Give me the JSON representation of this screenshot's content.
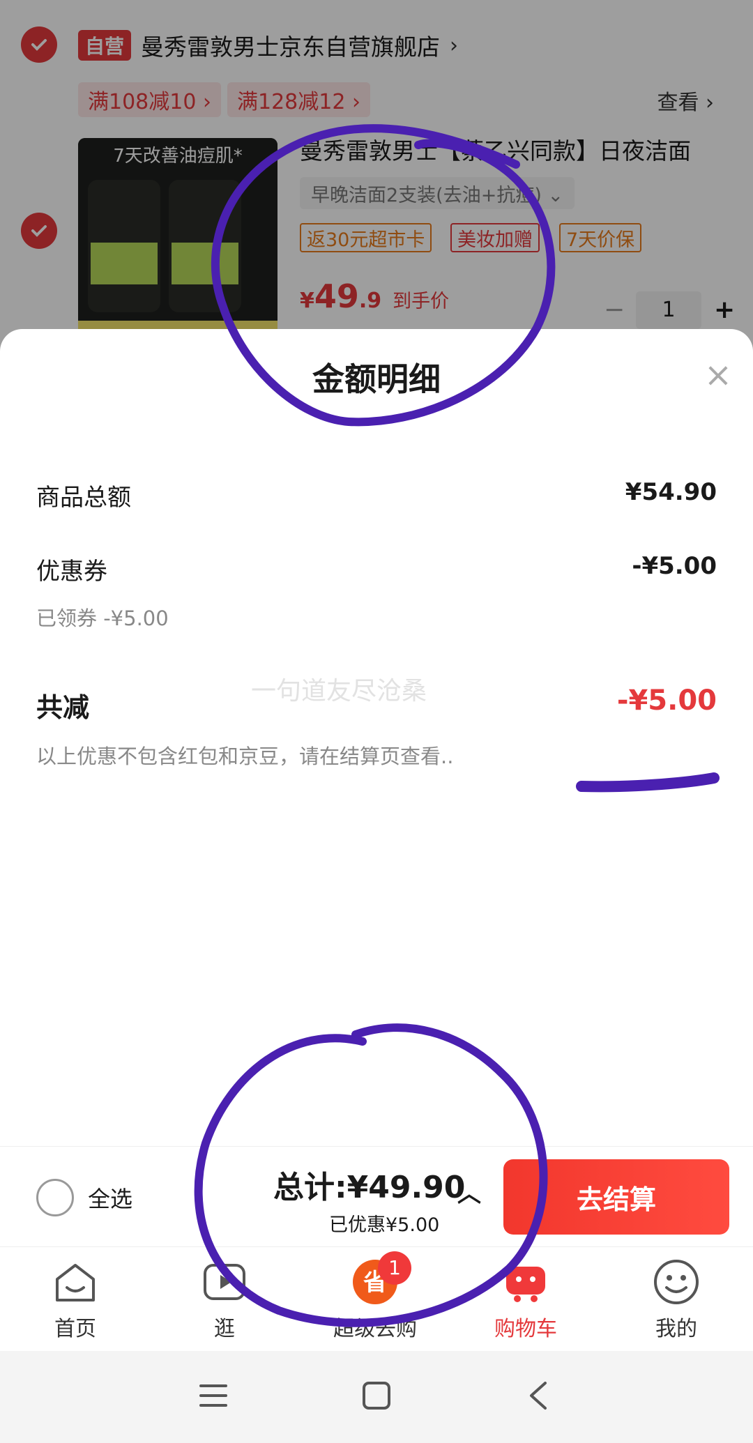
{
  "shop": {
    "badge": "自营",
    "name": "曼秀雷敦男士京东自营旗舰店",
    "arrow": "›",
    "promos": [
      "满108减10 ›",
      "满128减12 ›"
    ],
    "view_more": "查看 ›"
  },
  "product": {
    "title": "曼秀雷敦男士【蔡乙兴同款】日夜洁面",
    "variant": "早晚洁面2支装(去油+抗痘)  ⌄",
    "tags": [
      "返30元超市卡",
      "美妆加赠",
      "7天价保"
    ],
    "price_symbol": "¥",
    "price_int": "49",
    "price_dec": ".9",
    "price_label": "到手价",
    "quantity": "1",
    "image_headline": "7天改善油痘肌*"
  },
  "sheet": {
    "title": "金额明细",
    "close": "×",
    "rows": [
      {
        "label": "商品总额",
        "value": "¥54.90"
      },
      {
        "label": "优惠券",
        "value": "-¥5.00"
      }
    ],
    "coupon_note": "已领券 -¥5.00",
    "total_label": "共减",
    "total_value": "-¥5.00",
    "disclaimer": "以上优惠不包含红包和京豆，请在结算页查看..",
    "watermark": "一句道友尽沧桑"
  },
  "checkout_bar": {
    "select_all": "全选",
    "total": "总计:¥49.90",
    "saved": "已优惠¥5.00",
    "caret": "︿",
    "checkout_button": "去结算"
  },
  "tabs": [
    {
      "label": "首页",
      "icon": "home-icon"
    },
    {
      "label": "逛",
      "icon": "play-icon"
    },
    {
      "label": "超级去购",
      "icon": "save-icon",
      "badge": "1"
    },
    {
      "label": "购物车",
      "icon": "cart-icon",
      "active": true
    },
    {
      "label": "我的",
      "icon": "smiley-icon"
    }
  ],
  "colors": {
    "accent": "#e4393c",
    "annotation": "#4a20b0"
  }
}
